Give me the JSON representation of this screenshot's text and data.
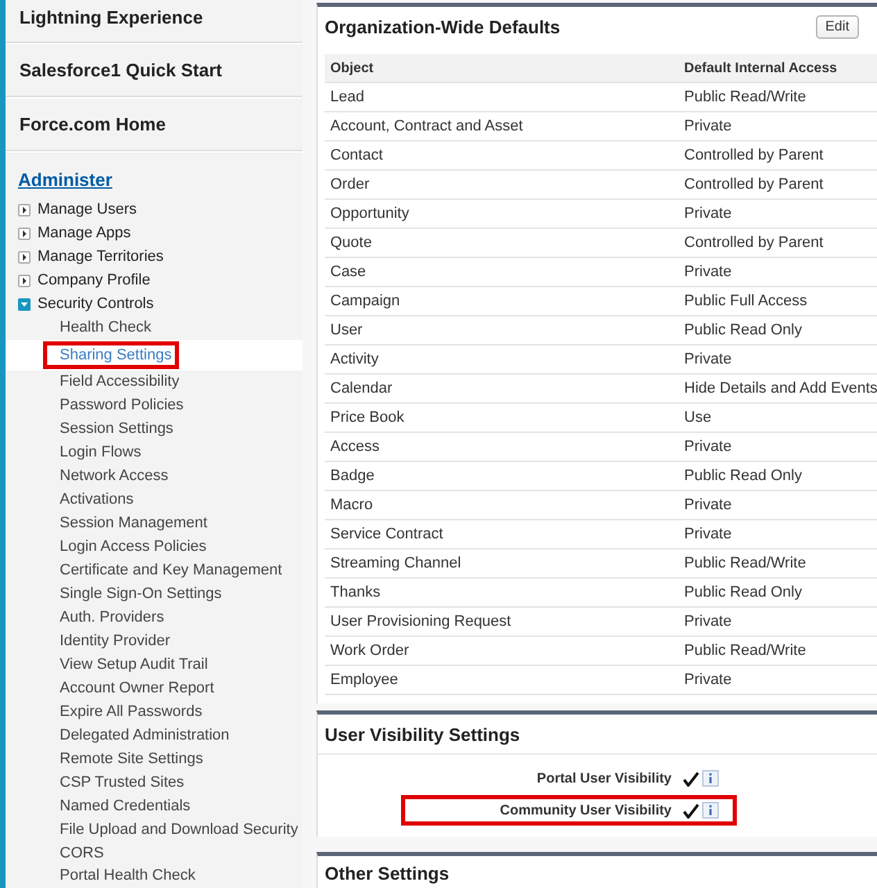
{
  "sidebar": {
    "top_links": [
      "Lightning Experience",
      "Salesforce1 Quick Start",
      "Force.com Home"
    ],
    "section_title": "Administer",
    "items": [
      {
        "label": "Manage Users",
        "expanded": false
      },
      {
        "label": "Manage Apps",
        "expanded": false
      },
      {
        "label": "Manage Territories",
        "expanded": false
      },
      {
        "label": "Company Profile",
        "expanded": false
      },
      {
        "label": "Security Controls",
        "expanded": true,
        "children": [
          {
            "label": "Health Check",
            "selected": false,
            "highlighted": false
          },
          {
            "label": "Sharing Settings",
            "selected": true,
            "highlighted": true
          },
          {
            "label": "Field Accessibility",
            "selected": false,
            "highlighted": false
          },
          {
            "label": "Password Policies",
            "selected": false,
            "highlighted": false
          },
          {
            "label": "Session Settings",
            "selected": false,
            "highlighted": false
          },
          {
            "label": "Login Flows",
            "selected": false,
            "highlighted": false
          },
          {
            "label": "Network Access",
            "selected": false,
            "highlighted": false
          },
          {
            "label": "Activations",
            "selected": false,
            "highlighted": false
          },
          {
            "label": "Session Management",
            "selected": false,
            "highlighted": false
          },
          {
            "label": "Login Access Policies",
            "selected": false,
            "highlighted": false
          },
          {
            "label": "Certificate and Key Management",
            "selected": false,
            "highlighted": false
          },
          {
            "label": "Single Sign-On Settings",
            "selected": false,
            "highlighted": false
          },
          {
            "label": "Auth. Providers",
            "selected": false,
            "highlighted": false
          },
          {
            "label": "Identity Provider",
            "selected": false,
            "highlighted": false
          },
          {
            "label": "View Setup Audit Trail",
            "selected": false,
            "highlighted": false
          },
          {
            "label": "Account Owner Report",
            "selected": false,
            "highlighted": false
          },
          {
            "label": "Expire All Passwords",
            "selected": false,
            "highlighted": false
          },
          {
            "label": "Delegated Administration",
            "selected": false,
            "highlighted": false
          },
          {
            "label": "Remote Site Settings",
            "selected": false,
            "highlighted": false
          },
          {
            "label": "CSP Trusted Sites",
            "selected": false,
            "highlighted": false
          },
          {
            "label": "Named Credentials",
            "selected": false,
            "highlighted": false
          },
          {
            "label": "File Upload and Download Security",
            "selected": false,
            "highlighted": false
          },
          {
            "label": "CORS",
            "selected": false,
            "highlighted": false
          },
          {
            "label": "Portal Health Check",
            "selected": false,
            "highlighted": false
          }
        ]
      }
    ]
  },
  "org_defaults": {
    "title": "Organization-Wide Defaults",
    "edit_button": "Edit",
    "columns": [
      "Object",
      "Default Internal Access"
    ],
    "rows": [
      [
        "Lead",
        "Public Read/Write"
      ],
      [
        "Account, Contract and Asset",
        "Private"
      ],
      [
        "Contact",
        "Controlled by Parent"
      ],
      [
        "Order",
        "Controlled by Parent"
      ],
      [
        "Opportunity",
        "Private"
      ],
      [
        "Quote",
        "Controlled by Parent"
      ],
      [
        "Case",
        "Private"
      ],
      [
        "Campaign",
        "Public Full Access"
      ],
      [
        "User",
        "Public Read Only"
      ],
      [
        "Activity",
        "Private"
      ],
      [
        "Calendar",
        "Hide Details and Add Events"
      ],
      [
        "Price Book",
        "Use"
      ],
      [
        "Access",
        "Private"
      ],
      [
        "Badge",
        "Public Read Only"
      ],
      [
        "Macro",
        "Private"
      ],
      [
        "Service Contract",
        "Private"
      ],
      [
        "Streaming Channel",
        "Public Read/Write"
      ],
      [
        "Thanks",
        "Public Read Only"
      ],
      [
        "User Provisioning Request",
        "Private"
      ],
      [
        "Work Order",
        "Public Read/Write"
      ],
      [
        "Employee",
        "Private"
      ]
    ]
  },
  "user_visibility": {
    "title": "User Visibility Settings",
    "rows": [
      {
        "label": "Portal User Visibility",
        "checked": true,
        "highlighted": false
      },
      {
        "label": "Community User Visibility",
        "checked": true,
        "highlighted": true
      }
    ]
  },
  "other_settings": {
    "title": "Other Settings"
  }
}
